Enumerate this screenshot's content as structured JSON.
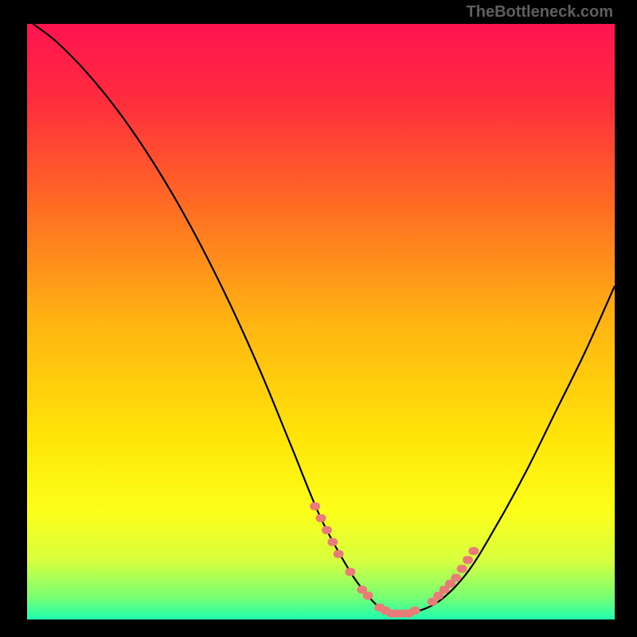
{
  "attribution": "TheBottleneck.com",
  "colors": {
    "gradient_stops": [
      {
        "offset": 0.0,
        "color": "#ff1450"
      },
      {
        "offset": 0.12,
        "color": "#ff2a3f"
      },
      {
        "offset": 0.3,
        "color": "#ff6a24"
      },
      {
        "offset": 0.5,
        "color": "#ffb412"
      },
      {
        "offset": 0.7,
        "color": "#ffe608"
      },
      {
        "offset": 0.82,
        "color": "#fbff1a"
      },
      {
        "offset": 0.9,
        "color": "#d8ff3e"
      },
      {
        "offset": 0.96,
        "color": "#7dff70"
      },
      {
        "offset": 1.0,
        "color": "#1effb0"
      }
    ],
    "curve": "#000000",
    "markers": "#e97c78",
    "background": "#000000"
  },
  "chart_data": {
    "type": "line",
    "title": "",
    "xlabel": "",
    "ylabel": "",
    "xlim": [
      0,
      100
    ],
    "ylim": [
      0,
      100
    ],
    "series": [
      {
        "name": "bottleneck-curve",
        "x": [
          1,
          5,
          10,
          15,
          20,
          25,
          30,
          35,
          40,
          45,
          50,
          55,
          58,
          60,
          62,
          65,
          70,
          75,
          80,
          85,
          90,
          95,
          100
        ],
        "y": [
          100,
          97,
          92,
          86,
          79,
          71,
          62,
          52,
          41,
          29,
          17,
          8,
          4,
          2,
          1,
          1,
          3,
          8,
          16,
          25,
          35,
          45,
          56
        ]
      }
    ],
    "markers": {
      "name": "highlight-dots",
      "x": [
        49,
        50,
        51,
        52,
        53,
        55,
        57,
        58,
        60,
        61,
        62,
        63,
        64,
        65,
        66,
        69,
        70,
        71,
        72,
        73,
        74,
        75,
        76
      ],
      "y": [
        19,
        17,
        15,
        13,
        11,
        8,
        5,
        4,
        2,
        1.5,
        1,
        1,
        1,
        1,
        1.5,
        3,
        4,
        5,
        6,
        7,
        8.5,
        10,
        11.5
      ]
    }
  }
}
